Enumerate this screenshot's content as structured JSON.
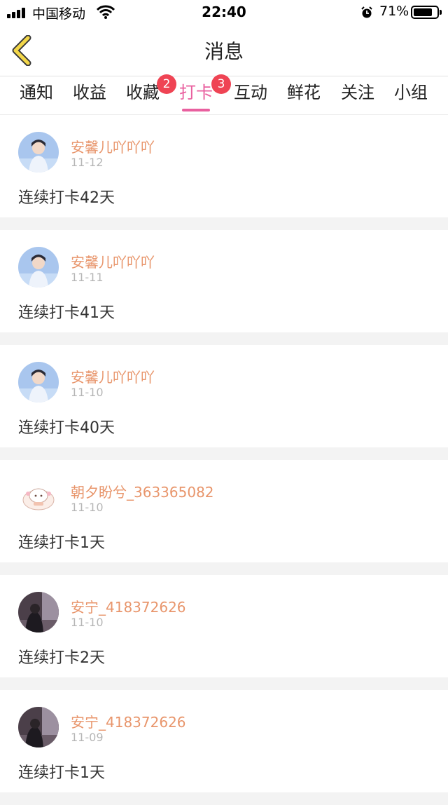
{
  "status_bar": {
    "carrier": "中国移动",
    "time": "22:40",
    "battery": "71%"
  },
  "nav": {
    "title": "消息",
    "back_icon": "chevron-left-icon"
  },
  "tabs": [
    {
      "label": "通知",
      "badge": ""
    },
    {
      "label": "收益",
      "badge": ""
    },
    {
      "label": "收藏",
      "badge": "2"
    },
    {
      "label": "打卡",
      "badge": "3",
      "active": true
    },
    {
      "label": "互动",
      "badge": ""
    },
    {
      "label": "鲜花",
      "badge": ""
    },
    {
      "label": "关注",
      "badge": ""
    },
    {
      "label": "小组",
      "badge": ""
    }
  ],
  "messages": [
    {
      "name": "安馨儿吖吖吖",
      "date": "11-12",
      "content": "连续打卡42天",
      "avatar": "user-photo"
    },
    {
      "name": "安馨儿吖吖吖",
      "date": "11-11",
      "content": "连续打卡41天",
      "avatar": "user-photo"
    },
    {
      "name": "安馨儿吖吖吖",
      "date": "11-10",
      "content": "连续打卡40天",
      "avatar": "user-photo"
    },
    {
      "name": "朝夕盼兮_363365082",
      "date": "11-10",
      "content": "连续打卡1天",
      "avatar": "cartoon-sticker"
    },
    {
      "name": "安宁_418372626",
      "date": "11-10",
      "content": "连续打卡2天",
      "avatar": "dark-photo"
    },
    {
      "name": "安宁_418372626",
      "date": "11-09",
      "content": "连续打卡1天",
      "avatar": "dark-photo"
    }
  ],
  "colors": {
    "accent": "#e9609f",
    "badge": "#ef4454",
    "name": "#e8956b",
    "back_icon": "#e2c23a"
  }
}
